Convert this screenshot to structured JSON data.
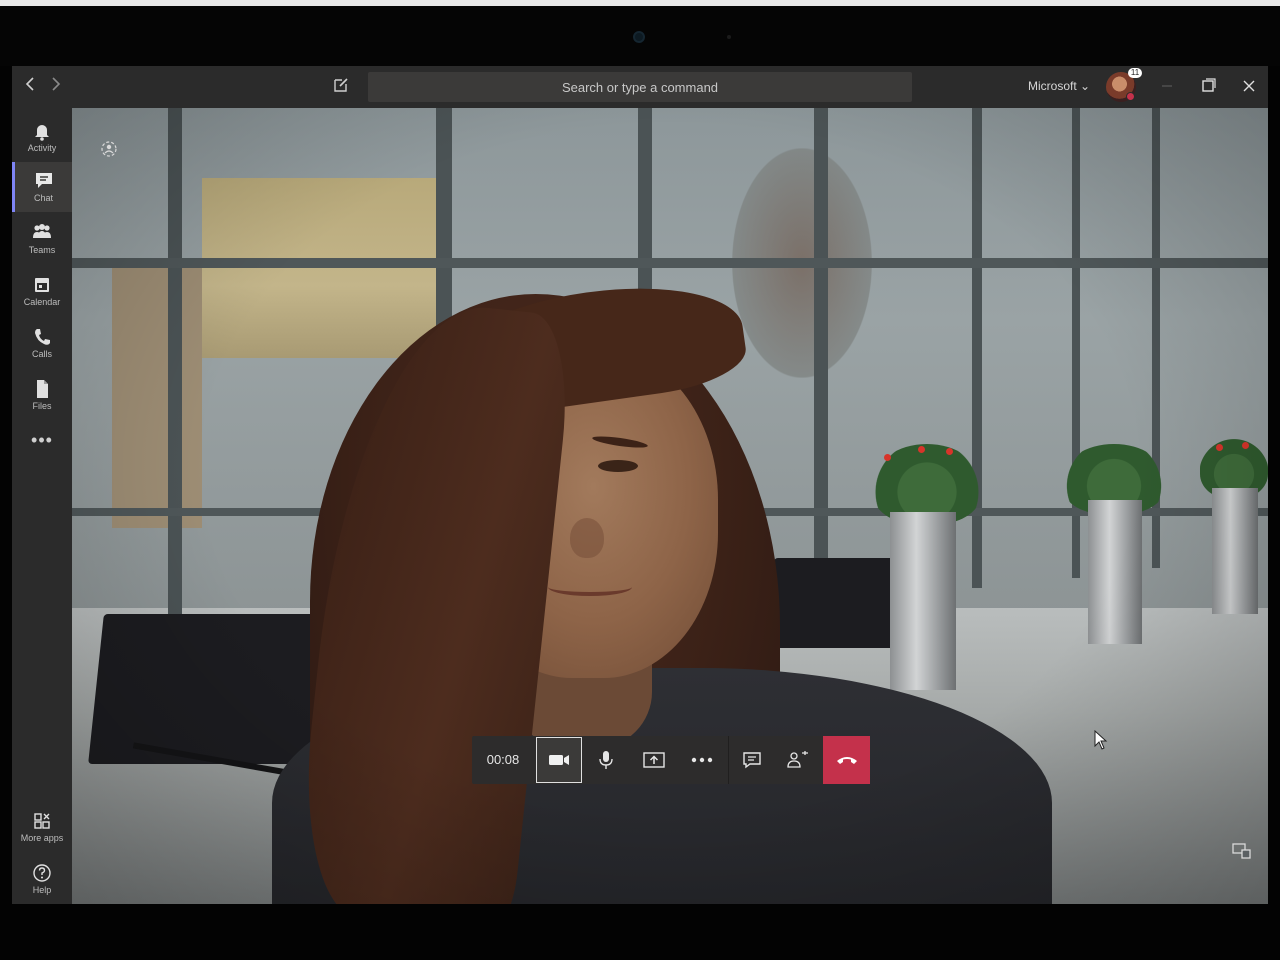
{
  "titlebar": {
    "search_placeholder": "Search or type a command",
    "tenant": "Microsoft ⌄",
    "badge": "11"
  },
  "rail": {
    "items": [
      {
        "label": "Activity",
        "icon": "bell-icon"
      },
      {
        "label": "Chat",
        "icon": "chat-icon"
      },
      {
        "label": "Teams",
        "icon": "teams-icon"
      },
      {
        "label": "Calendar",
        "icon": "calendar-icon"
      },
      {
        "label": "Calls",
        "icon": "phone-icon"
      },
      {
        "label": "Files",
        "icon": "file-icon"
      }
    ],
    "more": "•••",
    "bottom": [
      {
        "label": "More apps",
        "icon": "apps-icon"
      },
      {
        "label": "Help",
        "icon": "help-icon"
      }
    ]
  },
  "call": {
    "timer": "00:08"
  },
  "colors": {
    "accent": "#7f85f5",
    "hangup": "#c4314b",
    "rail": "#2b2b2b",
    "toolbar": "#2d2c2c"
  }
}
